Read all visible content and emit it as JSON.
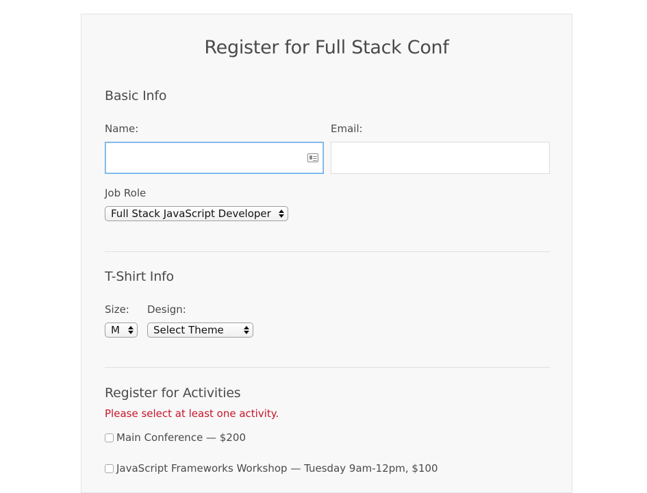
{
  "form": {
    "title": "Register for Full Stack Conf",
    "basic_info": {
      "heading": "Basic Info",
      "name_label": "Name:",
      "name_value": "",
      "email_label": "Email:",
      "email_value": "",
      "job_role_label": "Job Role",
      "job_role_selected": "Full Stack JavaScript Developer"
    },
    "tshirt_info": {
      "heading": "T-Shirt Info",
      "size_label": "Size:",
      "size_selected": "M",
      "design_label": "Design:",
      "design_selected": "Select Theme"
    },
    "activities": {
      "heading": "Register for Activities",
      "error": "Please select at least one activity.",
      "items": [
        {
          "label": "Main Conference — $200",
          "checked": false
        },
        {
          "label": "JavaScript Frameworks Workshop — Tuesday 9am-12pm, $100",
          "checked": false
        }
      ]
    }
  },
  "icons": {
    "autofill": "contact-card-icon"
  },
  "colors": {
    "error": "#c8142a",
    "focus_border": "#6aaee6",
    "panel_bg": "#f8f8f8"
  }
}
